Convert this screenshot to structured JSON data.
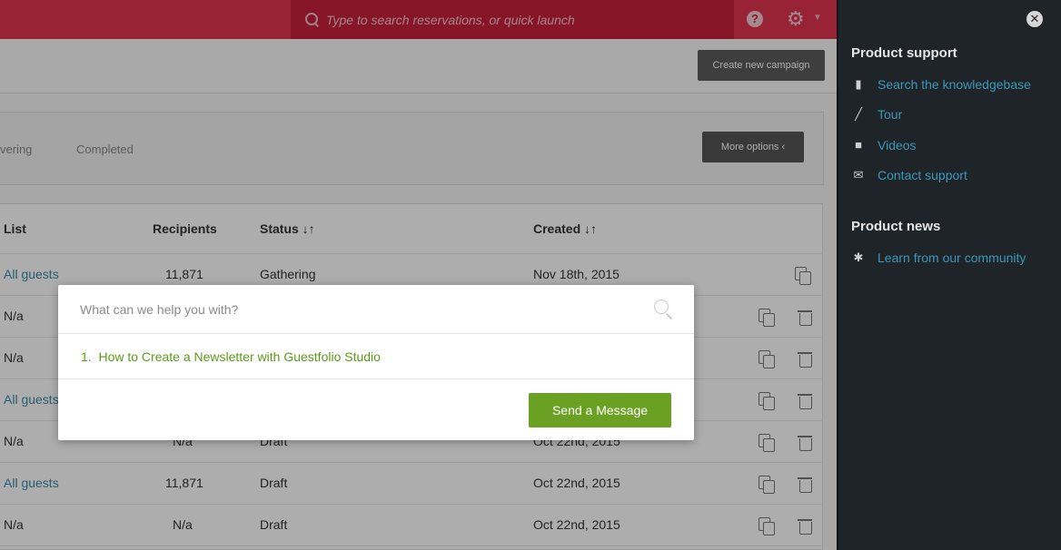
{
  "topbar": {
    "search_placeholder": "Type to search reservations, or quick launch",
    "help_icon": "question-circle-icon",
    "gear_icon": "gear-icon"
  },
  "toolbar": {
    "create_campaign": "Create new campaign",
    "more_options": "More options ‹"
  },
  "tabs": {
    "delivering": "vering",
    "completed": "Completed"
  },
  "table": {
    "headers": {
      "list": "List",
      "recipients": "Recipients",
      "status": "Status ↓↑",
      "created": "Created ↓↑"
    },
    "rows": [
      {
        "list": "All guests",
        "recipients": "11,871",
        "status": "Gathering",
        "created": "Nov 18th, 2015"
      },
      {
        "list": "N/a",
        "recipients": "",
        "status": "",
        "created": ""
      },
      {
        "list": "N/a",
        "recipients": "",
        "status": "",
        "created": ""
      },
      {
        "list": "All guests",
        "recipients": "",
        "status": "",
        "created": ""
      },
      {
        "list": "N/a",
        "recipients": "N/a",
        "status": "Draft",
        "created": "Oct 22nd, 2015"
      },
      {
        "list": "All guests",
        "recipients": "11,871",
        "status": "Draft",
        "created": "Oct 22nd, 2015"
      },
      {
        "list": "N/a",
        "recipients": "N/a",
        "status": "Draft",
        "created": "Oct 22nd, 2015"
      }
    ]
  },
  "modal": {
    "search_placeholder": "What can we help you with?",
    "result_number": "1.",
    "result_title": "How to Create a Newsletter with Guestfolio Studio",
    "send_button": "Send a Message"
  },
  "panel": {
    "support_heading": "Product support",
    "support_items": [
      {
        "icon": "book-icon",
        "label": "Search the knowledgebase"
      },
      {
        "icon": "magic-wand-icon",
        "label": "Tour"
      },
      {
        "icon": "video-camera-icon",
        "label": "Videos"
      },
      {
        "icon": "envelope-icon",
        "label": "Contact support"
      }
    ],
    "news_heading": "Product news",
    "news_items": [
      {
        "icon": "asterisk-icon",
        "label": "Learn from our community"
      }
    ]
  },
  "colors": {
    "topbar": "#e1344f",
    "search_bg": "#c8203c",
    "link": "#3a8aa8",
    "accent_green": "#6aa123",
    "panel_bg": "#1e2428"
  }
}
